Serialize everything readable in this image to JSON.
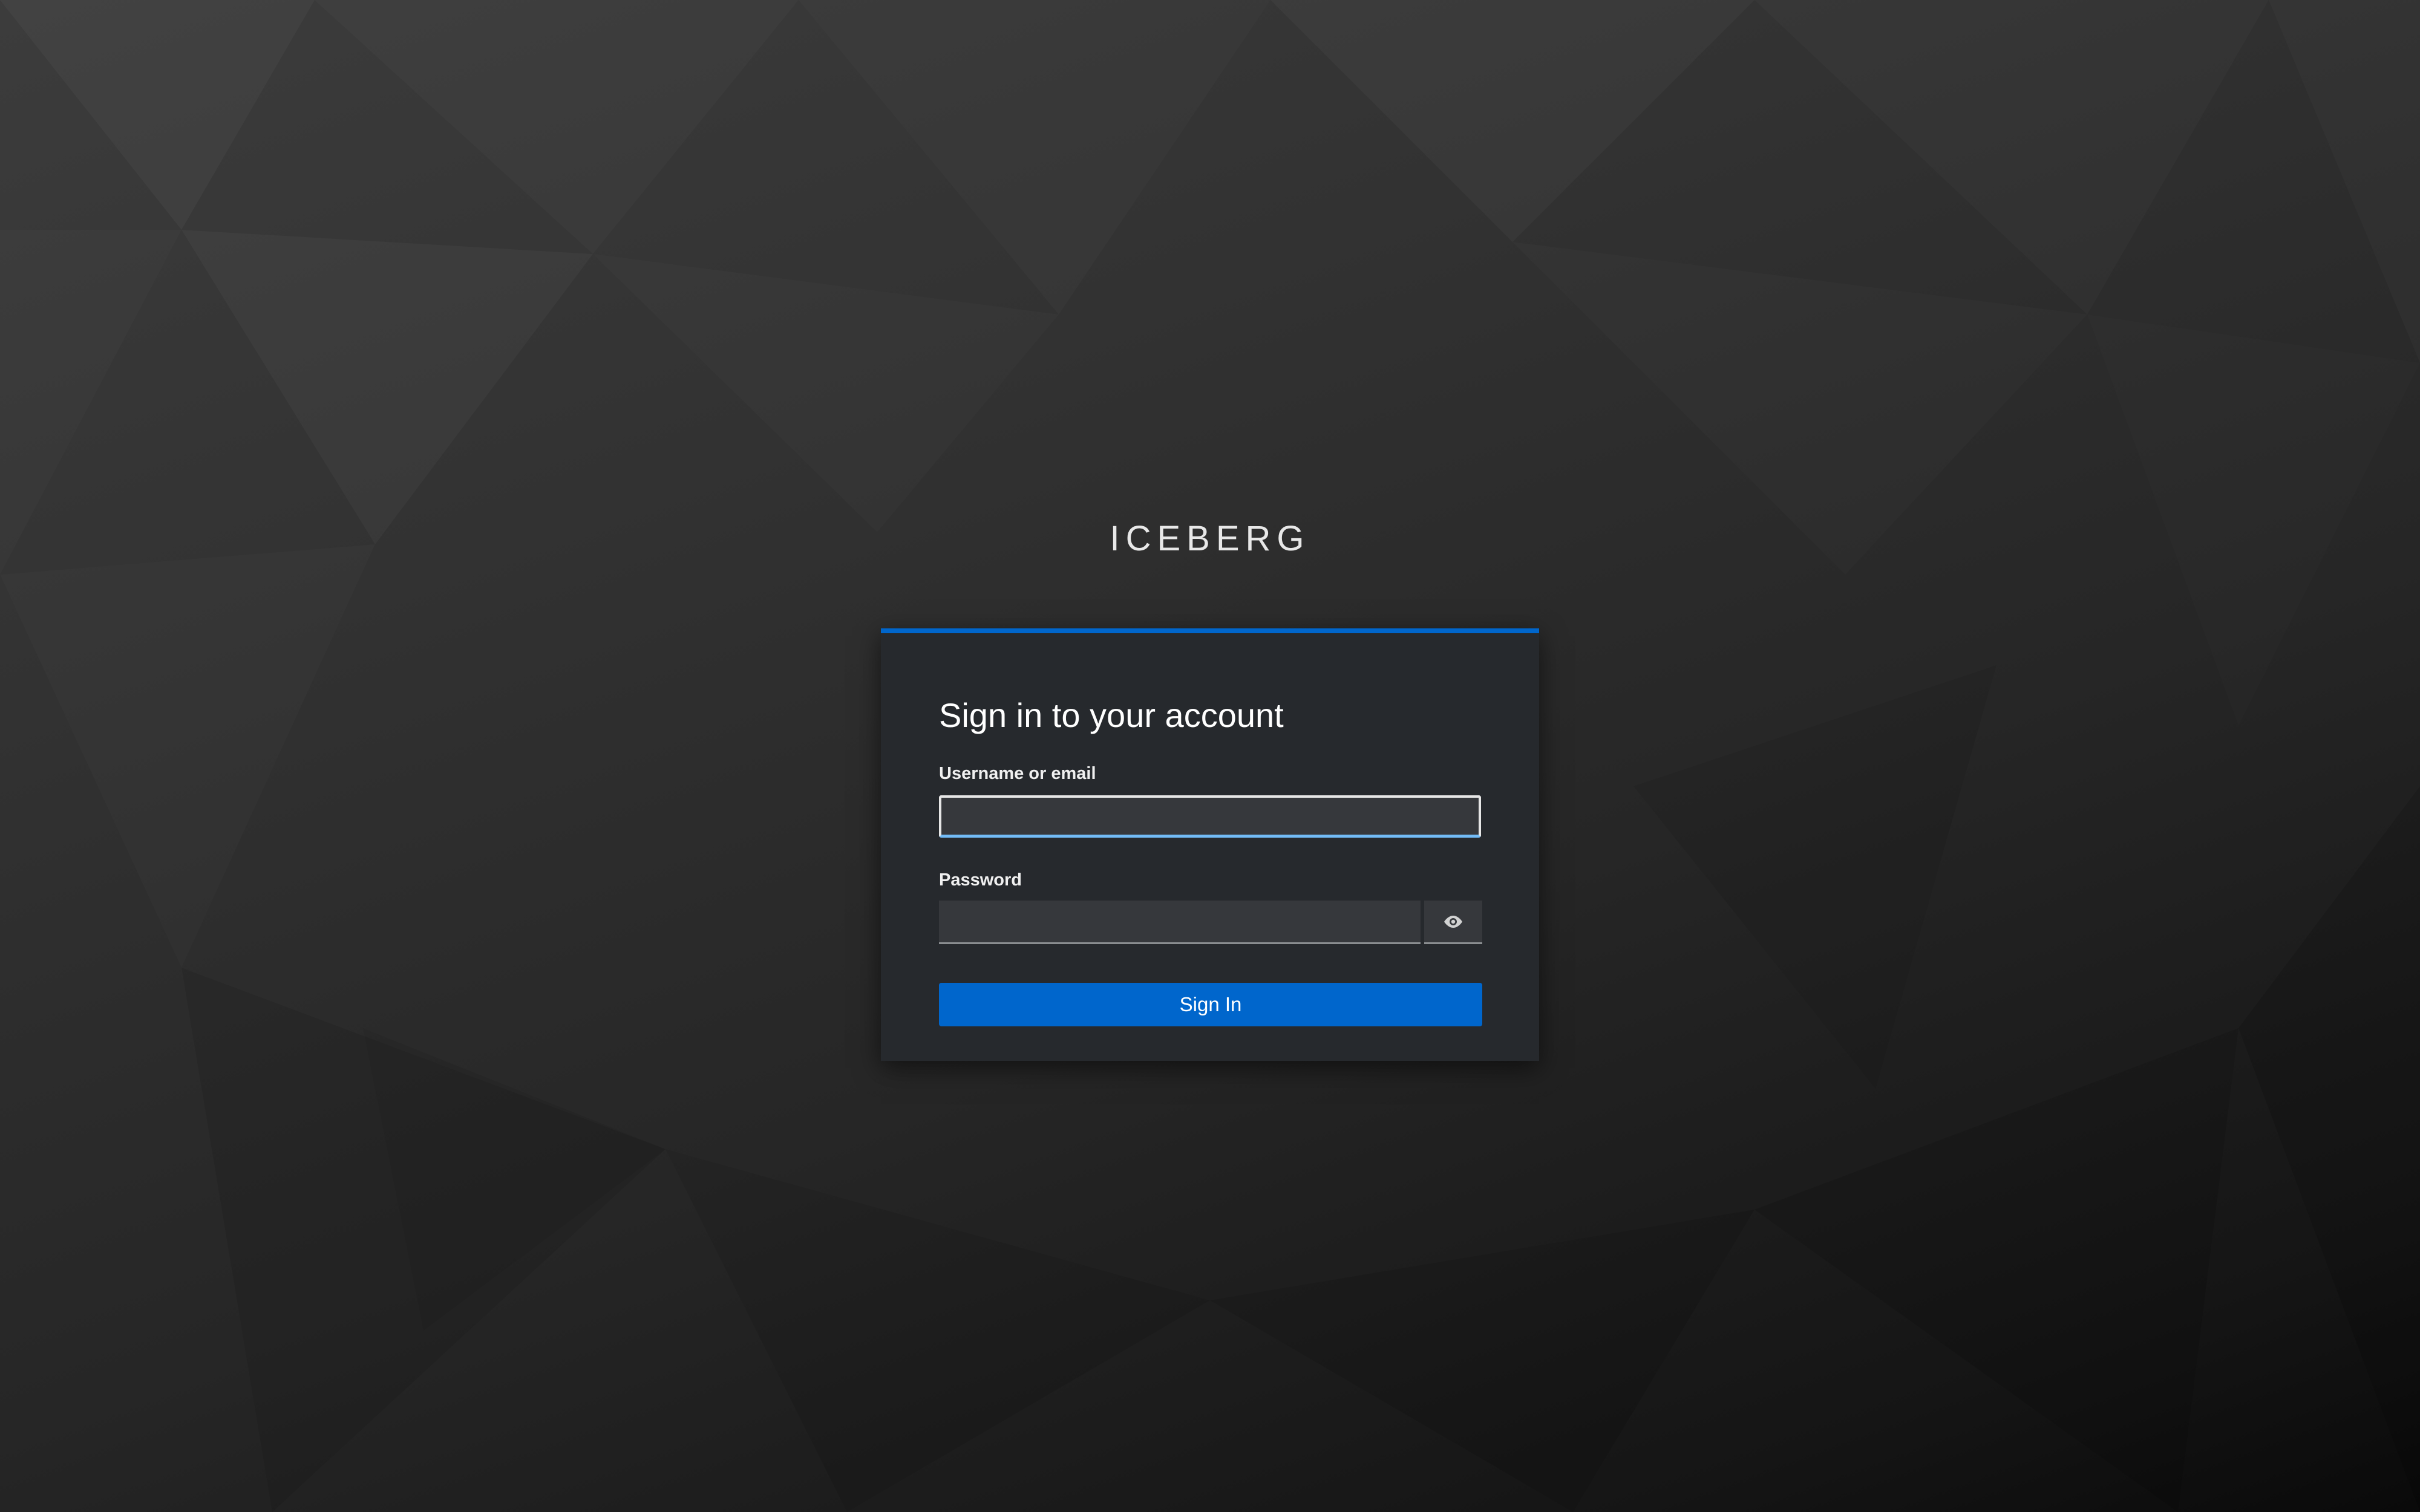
{
  "brand": {
    "title": "ICEBERG"
  },
  "login_card": {
    "heading": "Sign in to your account",
    "accent_color": "#0066cc",
    "username": {
      "label": "Username or email",
      "value": "",
      "placeholder": ""
    },
    "password": {
      "label": "Password",
      "value": "",
      "placeholder": "",
      "toggle_icon": "eye-icon"
    },
    "submit": {
      "label": "Sign In",
      "color": "#0066cc"
    }
  }
}
